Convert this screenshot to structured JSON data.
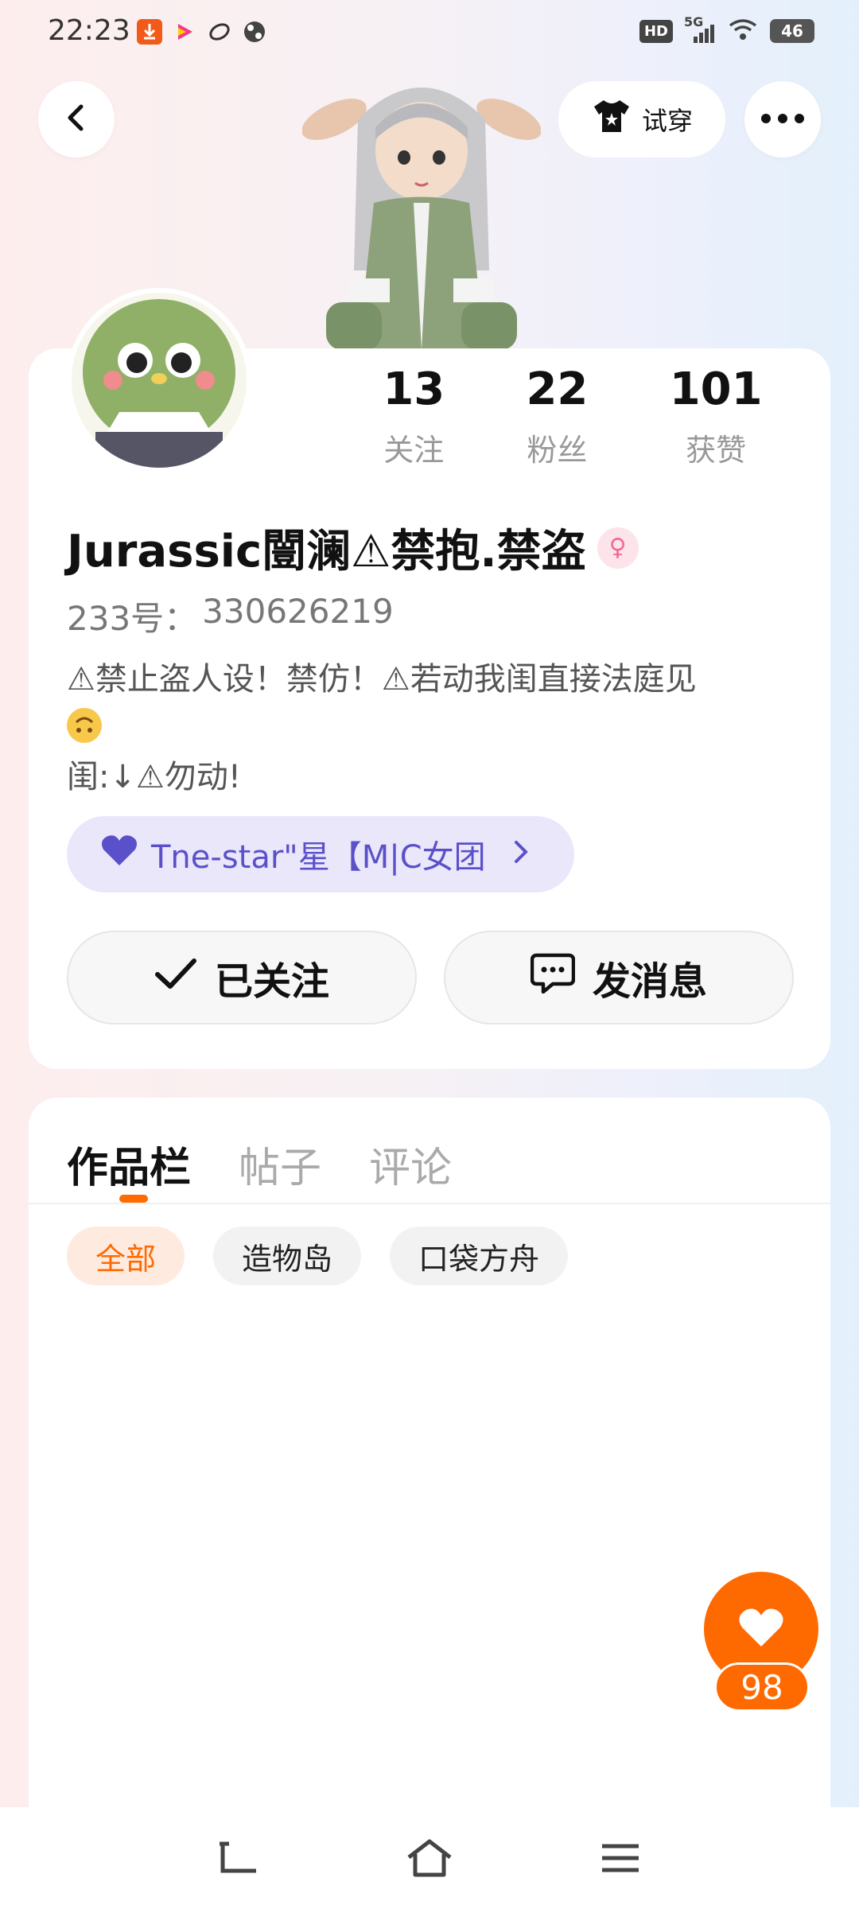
{
  "status_bar": {
    "time": "22:23",
    "app_icons": [
      "download-app-icon",
      "video-app-icon",
      "link-app-icon",
      "pinwheel-app-icon"
    ],
    "network_badge": "HD",
    "signal_label": "5G",
    "battery_level": "46"
  },
  "header": {
    "tryon_label": "试穿"
  },
  "profile": {
    "stats": [
      {
        "count": "13",
        "label": "关注"
      },
      {
        "count": "22",
        "label": "粉丝"
      },
      {
        "count": "101",
        "label": "获赞"
      }
    ],
    "username": "Jurassic闓澜⚠禁抱.禁盗",
    "gender_symbol": "♀",
    "uid_label": "233号：",
    "uid_value": "330626219",
    "bio_line1": "⚠禁止盗人设！禁仿！⚠若动我闺直接法庭见",
    "bio_line2": "闺:↓⚠勿动!",
    "group_name": "Tne-star\"星【M|C女团",
    "follow_label": "已关注",
    "message_label": "发消息"
  },
  "works": {
    "tabs": [
      {
        "label": "作品栏",
        "active": true
      },
      {
        "label": "帖子",
        "active": false
      },
      {
        "label": "评论",
        "active": false
      }
    ],
    "filters": [
      {
        "label": "全部",
        "active": true
      },
      {
        "label": "造物岛",
        "active": false
      },
      {
        "label": "口袋方舟",
        "active": false
      }
    ]
  },
  "like_count": "98",
  "colors": {
    "accent": "#ff6a00",
    "group_pill_bg": "#eae7fb",
    "group_text": "#5a50c9",
    "gender_pink": "#f06a92"
  }
}
